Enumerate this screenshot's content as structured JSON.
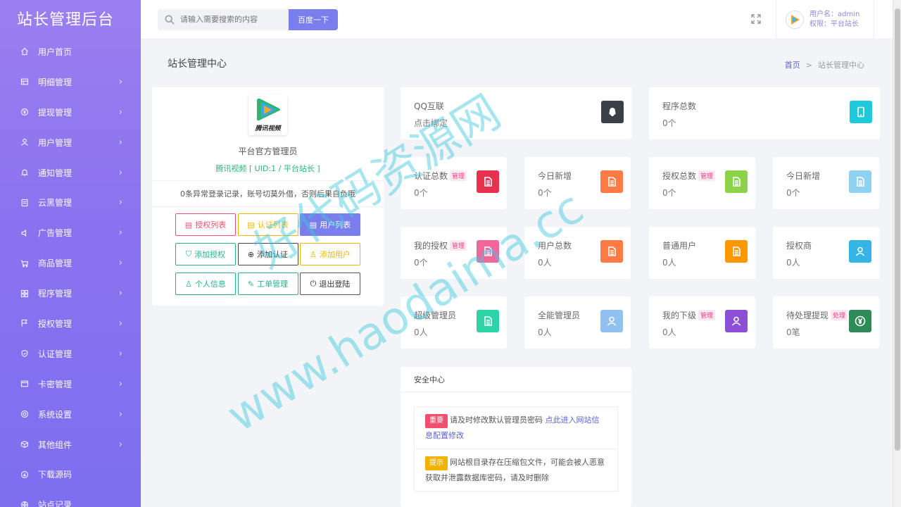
{
  "brand": "站长管理后台",
  "sidebar": {
    "items": [
      {
        "label": "用户首页",
        "chevron": false
      },
      {
        "label": "明细管理",
        "chevron": true
      },
      {
        "label": "提现管理",
        "chevron": true
      },
      {
        "label": "用户管理",
        "chevron": true
      },
      {
        "label": "通知管理",
        "chevron": true
      },
      {
        "label": "云黑管理",
        "chevron": true
      },
      {
        "label": "广告管理",
        "chevron": true
      },
      {
        "label": "商品管理",
        "chevron": true
      },
      {
        "label": "程序管理",
        "chevron": true
      },
      {
        "label": "授权管理",
        "chevron": true
      },
      {
        "label": "认证管理",
        "chevron": true
      },
      {
        "label": "卡密管理",
        "chevron": true
      },
      {
        "label": "系统设置",
        "chevron": true
      },
      {
        "label": "其他组件",
        "chevron": true
      },
      {
        "label": "下载源码",
        "chevron": false
      },
      {
        "label": "站点记录",
        "chevron": false
      }
    ],
    "chevron_glyph": "›"
  },
  "topbar": {
    "search_placeholder": "请输入需要搜索的内容",
    "search_button": "百度一下",
    "username": "用户名：admin",
    "role": "权限：平台站长"
  },
  "page": {
    "title": "站长管理中心",
    "breadcrumb_home": "首页",
    "breadcrumb_sep": ">",
    "breadcrumb_current": "站长管理中心"
  },
  "profile": {
    "logo_text": "腾讯视频",
    "name": "平台官方管理员",
    "sub": "腾讯视频 [ UID:1 / 平台站长 ]",
    "note": "0条异常登录记录，账号切莫外借，否则后果自负哦",
    "buttons": [
      {
        "label": "授权列表",
        "icon": "▤"
      },
      {
        "label": "认证列表",
        "icon": "▤"
      },
      {
        "label": "用户列表",
        "icon": "▤"
      },
      {
        "label": "添加授权",
        "icon": "⛉"
      },
      {
        "label": "添加认证",
        "icon": "⊕"
      },
      {
        "label": "添加用户",
        "icon": "♙"
      },
      {
        "label": "个人信息",
        "icon": "♙"
      },
      {
        "label": "工单管理",
        "icon": "✎"
      },
      {
        "label": "退出登陆",
        "icon": "⏻"
      }
    ]
  },
  "cards": [
    {
      "title": "QQ互联",
      "value": "点击绑定",
      "tag": "",
      "color": "#3a3f48",
      "icon": "qq-icon"
    },
    {
      "title": "程序总数",
      "value": "0个",
      "tag": "",
      "color": "#1ec9dc",
      "icon": "mobile-icon"
    },
    {
      "title": "认证总数",
      "value": "0个",
      "tag": "管理",
      "color": "#e8304f",
      "icon": "document-icon"
    },
    {
      "title": "今日新增",
      "value": "0个",
      "tag": "",
      "color": "#ff7a45",
      "icon": "document-icon"
    },
    {
      "title": "授权总数",
      "value": "0个",
      "tag": "管理",
      "color": "#8cd34a",
      "icon": "document-icon"
    },
    {
      "title": "今日新增",
      "value": "0个",
      "tag": "",
      "color": "#8fd1f0",
      "icon": "document-icon"
    },
    {
      "title": "我的授权",
      "value": "0个",
      "tag": "管理",
      "color": "#f2679b",
      "icon": "document-icon"
    },
    {
      "title": "用户总数",
      "value": "0人",
      "tag": "",
      "color": "#ff7a45",
      "icon": "document-icon"
    },
    {
      "title": "普通用户",
      "value": "0人",
      "tag": "",
      "color": "#ff9800",
      "icon": "document-icon"
    },
    {
      "title": "授权商",
      "value": "0人",
      "tag": "",
      "color": "#34b5e5",
      "icon": "user-icon"
    },
    {
      "title": "超级管理员",
      "value": "0人",
      "tag": "",
      "color": "#2ed4a7",
      "icon": "document-icon"
    },
    {
      "title": "全能管理员",
      "value": "0人",
      "tag": "",
      "color": "#93c1ef",
      "icon": "user-icon"
    },
    {
      "title": "我的下级",
      "value": "0人",
      "tag": "管理",
      "color": "#8c4fd6",
      "icon": "user-icon"
    },
    {
      "title": "待处理提现",
      "value": "0笔",
      "tag": "处理",
      "color": "#2e8b57",
      "icon": "yen-icon"
    }
  ],
  "security": {
    "title": "安全中心",
    "items": [
      {
        "badge": "重要",
        "badge_color": "#f0506e",
        "text": "请及时修改默认管理员密码 ",
        "link": "点此进入网站信息配置修改"
      },
      {
        "badge": "提示",
        "badge_color": "#f0b400",
        "text": "网站根目录存在压缩包文件，可能会被人恶意获取并泄露数据库密码，请及时删除",
        "link": ""
      }
    ]
  },
  "watermark": {
    "line1": "好代码资源网",
    "line2": "www.haodaima.cc"
  }
}
